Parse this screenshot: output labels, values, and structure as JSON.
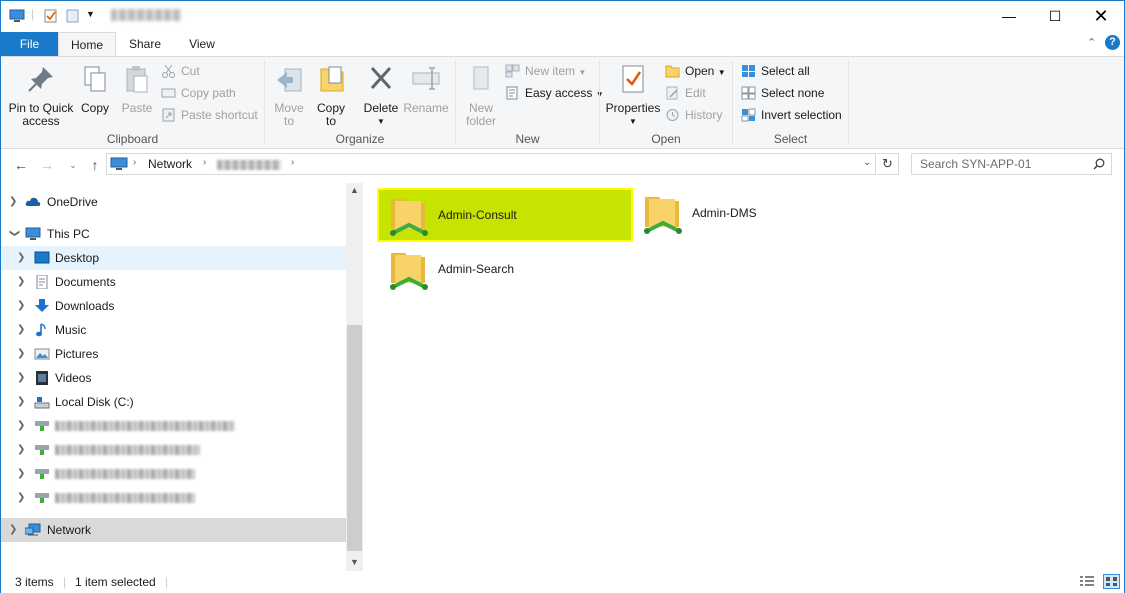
{
  "window": {
    "title": ""
  },
  "tabs": [
    {
      "label": "File"
    },
    {
      "label": "Home"
    },
    {
      "label": "Share"
    },
    {
      "label": "View"
    }
  ],
  "ribbon": {
    "clipboard": {
      "label": "Clipboard",
      "pin": "Pin to Quick access",
      "pin_line1": "Pin to Quick",
      "pin_line2": "access",
      "copy": "Copy",
      "paste": "Paste",
      "cut": "Cut",
      "copy_path": "Copy path",
      "paste_shortcut": "Paste shortcut"
    },
    "organize": {
      "label": "Organize",
      "move_to": "Move",
      "move_to2": "to",
      "copy_to": "Copy",
      "copy_to2": "to",
      "delete": "Delete",
      "rename": "Rename"
    },
    "new": {
      "label": "New",
      "new_folder": "New",
      "new_folder2": "folder",
      "new_item": "New item",
      "easy_access": "Easy access"
    },
    "open": {
      "label": "Open",
      "properties": "Properties",
      "open": "Open",
      "edit": "Edit",
      "history": "History"
    },
    "select": {
      "label": "Select",
      "select_all": "Select all",
      "select_none": "Select none",
      "invert": "Invert selection"
    }
  },
  "address": {
    "crumbs": [
      "Network"
    ],
    "search_placeholder": "Search SYN-APP-01"
  },
  "nav": {
    "items": [
      {
        "label": "OneDrive",
        "icon": "cloud-icon"
      },
      {
        "label": "This PC",
        "icon": "computer-icon"
      },
      {
        "label": "Desktop",
        "icon": "desktop-icon"
      },
      {
        "label": "Documents",
        "icon": "documents-icon"
      },
      {
        "label": "Downloads",
        "icon": "downloads-icon"
      },
      {
        "label": "Music",
        "icon": "music-icon"
      },
      {
        "label": "Pictures",
        "icon": "pictures-icon"
      },
      {
        "label": "Videos",
        "icon": "videos-icon"
      },
      {
        "label": "Local Disk (C:)",
        "icon": "drive-icon"
      },
      {
        "label": "Network",
        "icon": "network-icon"
      }
    ]
  },
  "content": {
    "items": [
      {
        "label": "Admin-Consult",
        "selected": true
      },
      {
        "label": "Admin-DMS",
        "selected": false
      },
      {
        "label": "Admin-Search",
        "selected": false
      }
    ]
  },
  "status": {
    "count": "3 items",
    "selected": "1 item selected"
  },
  "colors": {
    "accent": "#1979ca",
    "selection": "#c7e400",
    "selection_border": "#ffff00"
  }
}
